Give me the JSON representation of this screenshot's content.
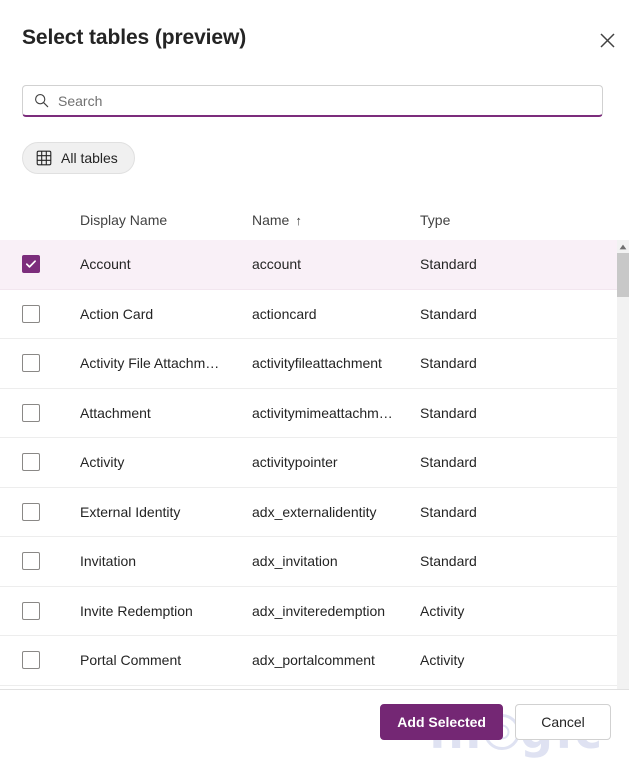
{
  "dialog": {
    "title": "Select tables (preview)",
    "close_label": "Close"
  },
  "search": {
    "placeholder": "Search",
    "value": "",
    "icon": "search-icon"
  },
  "filter": {
    "all_tables_label": "All tables",
    "icon": "grid-icon"
  },
  "table": {
    "columns": [
      {
        "key": "display_name",
        "label": "Display Name",
        "sort": ""
      },
      {
        "key": "name",
        "label": "Name",
        "sort": "↑"
      },
      {
        "key": "type",
        "label": "Type",
        "sort": ""
      }
    ],
    "rows": [
      {
        "display_name": "Account",
        "name": "account",
        "type": "Standard",
        "checked": true
      },
      {
        "display_name": "Action Card",
        "name": "actioncard",
        "type": "Standard",
        "checked": false
      },
      {
        "display_name": "Activity File Attachm…",
        "name": "activityfileattachment",
        "type": "Standard",
        "checked": false
      },
      {
        "display_name": "Attachment",
        "name": "activitymimeattachm…",
        "type": "Standard",
        "checked": false
      },
      {
        "display_name": "Activity",
        "name": "activitypointer",
        "type": "Standard",
        "checked": false
      },
      {
        "display_name": "External Identity",
        "name": "adx_externalidentity",
        "type": "Standard",
        "checked": false
      },
      {
        "display_name": "Invitation",
        "name": "adx_invitation",
        "type": "Standard",
        "checked": false
      },
      {
        "display_name": "Invite Redemption",
        "name": "adx_inviteredemption",
        "type": "Activity",
        "checked": false
      },
      {
        "display_name": "Portal Comment",
        "name": "adx_portalcomment",
        "type": "Activity",
        "checked": false
      }
    ]
  },
  "footer": {
    "primary_label": "Add Selected",
    "secondary_label": "Cancel"
  },
  "watermark": {
    "part1": "in",
    "part2": "g",
    "part3": "ic"
  },
  "colors": {
    "accent": "#742774",
    "checkbox_checked": "#7c2d7c",
    "selected_row_bg": "#f9f0f7",
    "watermark": "#c5cce8"
  }
}
